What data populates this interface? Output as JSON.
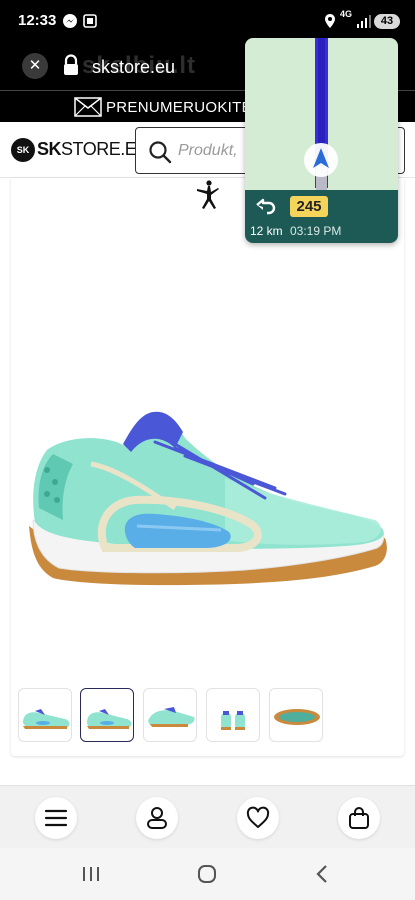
{
  "status_bar": {
    "time": "12:33",
    "network": "4G",
    "battery": "43"
  },
  "browser": {
    "url": "skstore.eu",
    "watermark": "skelbiu.lt"
  },
  "promo": {
    "text": "PRENUMERUOKITE N"
  },
  "header": {
    "logo_mark": "SK",
    "logo_bold": "SK",
    "logo_rest": "STORE.EU",
    "search_placeholder": "Produkt,"
  },
  "navigation_overlay": {
    "route_number": "245",
    "distance": "12 km",
    "eta": "03:19 PM"
  },
  "product": {
    "brand_icon": "jumpman-icon",
    "thumbnail_count": 5,
    "active_thumbnail": 1
  },
  "bottom_bar": {
    "items": [
      "menu-icon",
      "account-icon",
      "wishlist-icon",
      "cart-icon"
    ]
  },
  "system_nav": {
    "items": [
      "recent-apps-icon",
      "home-icon",
      "back-icon"
    ]
  },
  "colors": {
    "status_bar": "#000000",
    "nav_map": "#d4ecd4",
    "nav_info": "#1d5a55",
    "route_badge": "#f5d45c",
    "shoe_teal": "#8fe3cf",
    "shoe_blue": "#4a57d6",
    "sole_gum": "#c98a3e"
  }
}
